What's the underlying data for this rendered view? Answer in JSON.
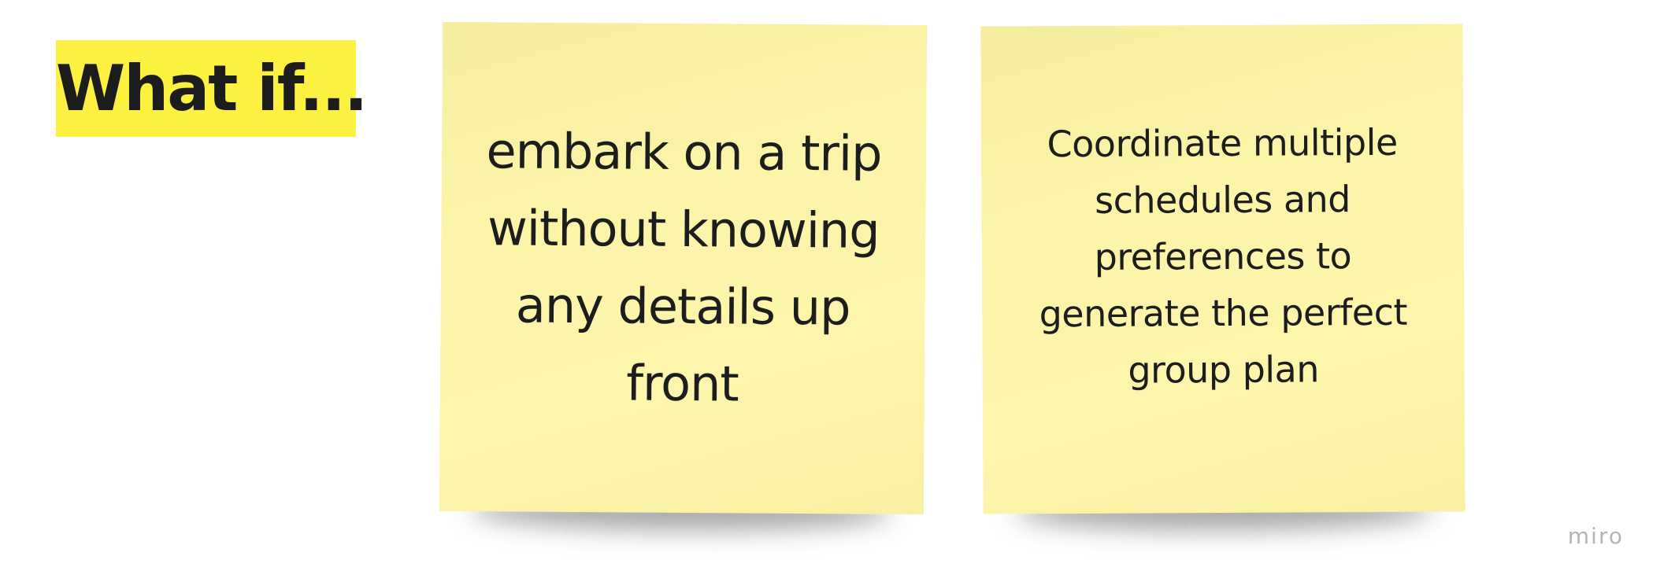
{
  "board": {
    "heading": "What if...",
    "stickies": [
      {
        "text": "embark on a trip without knowing any details up front",
        "color": "#fcf5ab"
      },
      {
        "text": "Coordinate multiple schedules and preferences to generate the perfect group plan",
        "color": "#fcf5ab"
      }
    ],
    "brand": "miro",
    "heading_highlight": "#fcf040"
  }
}
